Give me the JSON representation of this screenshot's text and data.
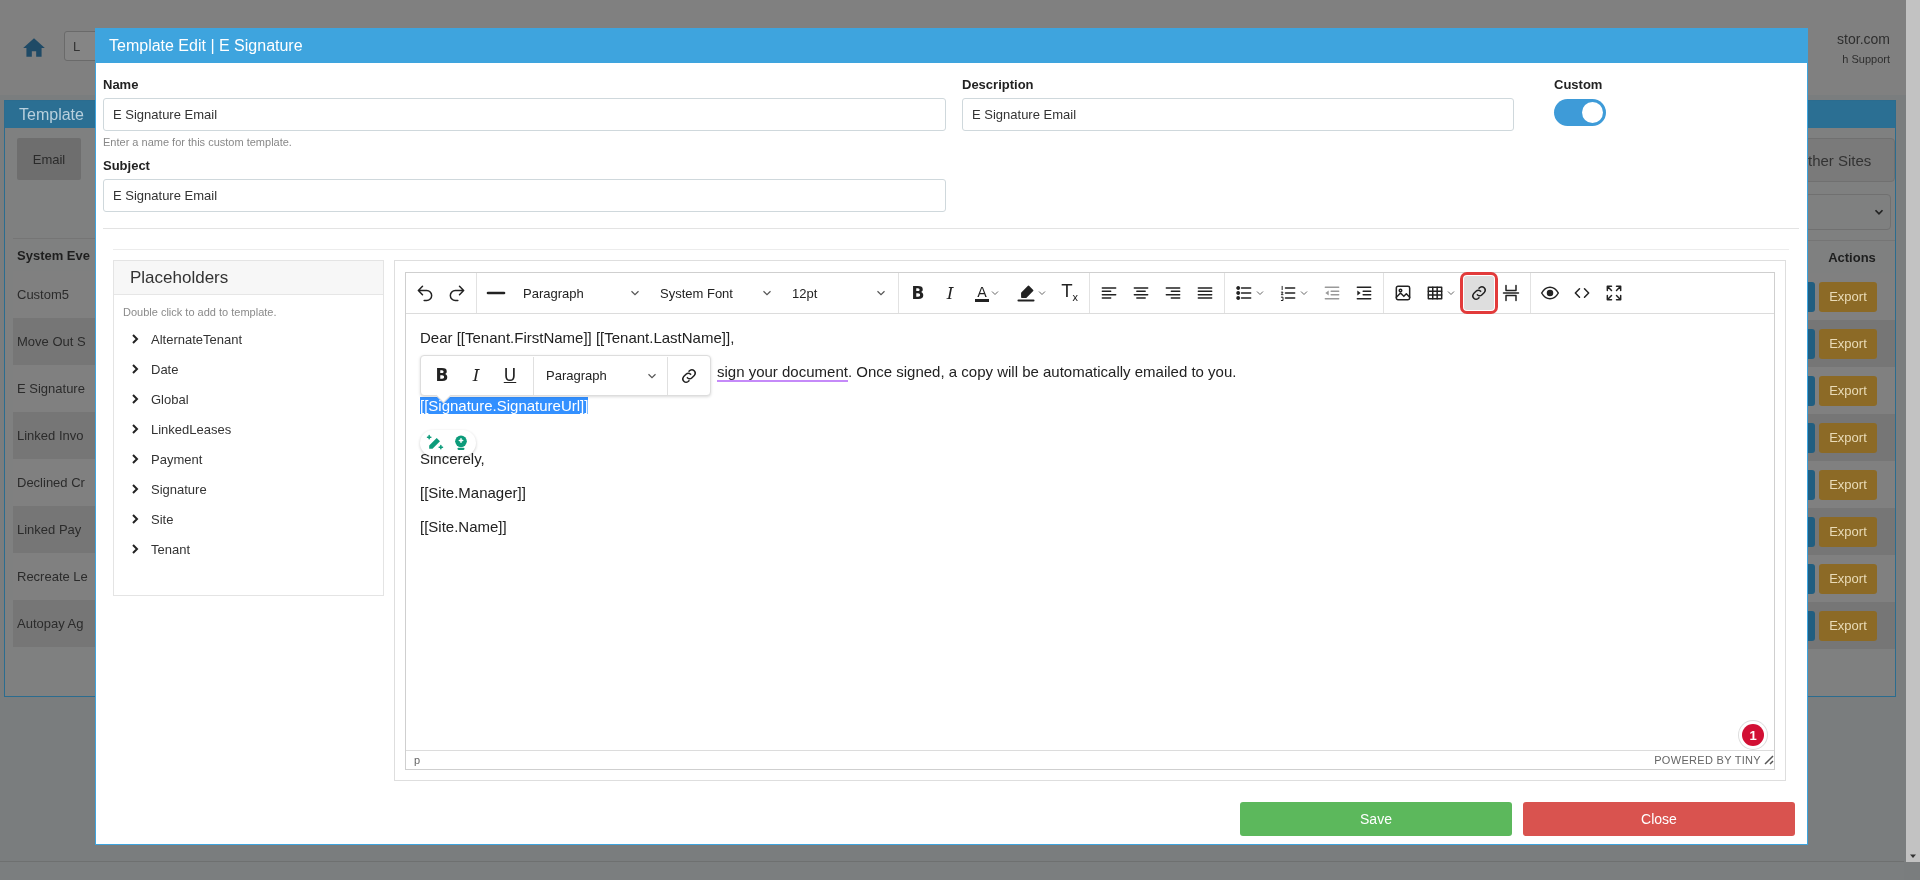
{
  "background": {
    "top_bar": {
      "field": "L",
      "site": "stor.com",
      "support": "h Support"
    },
    "panel": {
      "title": "Template",
      "tabs": [
        {
          "label": "Email"
        }
      ],
      "other_sites": "ther Sites",
      "table": {
        "columns": [
          "System Eve",
          "Actions"
        ],
        "rows": [
          {
            "event": "Custom5",
            "action": "Export"
          },
          {
            "event": "Move Out S",
            "action": "Export"
          },
          {
            "event": "E Signature",
            "action": "Export"
          },
          {
            "event": "Linked Invo",
            "action": "Export"
          },
          {
            "event": "Declined Cr",
            "action": "Export"
          },
          {
            "event": "Linked Pay",
            "action": "Export"
          },
          {
            "event": "Recreate Le",
            "action": "Export"
          },
          {
            "event": "Autopay Ag",
            "action": "Export"
          }
        ]
      }
    }
  },
  "modal": {
    "title": "Template Edit | E Signature",
    "name": {
      "label": "Name",
      "value": "E Signature Email",
      "hint": "Enter a name for this custom template."
    },
    "description": {
      "label": "Description",
      "value": "E Signature Email"
    },
    "custom": {
      "label": "Custom",
      "on": true
    },
    "subject": {
      "label": "Subject",
      "value": "E Signature Email"
    },
    "placeholders": {
      "title": "Placeholders",
      "hint": "Double click to add to template.",
      "items": [
        {
          "label": "AlternateTenant",
          "expanded": false
        },
        {
          "label": "Date",
          "expanded": false
        },
        {
          "label": "Global",
          "expanded": false
        },
        {
          "label": "LinkedLeases",
          "expanded": false
        },
        {
          "label": "Payment",
          "expanded": false
        },
        {
          "label": "Signature",
          "expanded": false
        },
        {
          "label": "Site",
          "expanded": false
        },
        {
          "label": "Tenant",
          "expanded": false
        }
      ]
    },
    "editor": {
      "toolbar": [
        [
          {
            "kind": "undo",
            "selected": false
          },
          {
            "kind": "redo",
            "selected": false
          }
        ],
        [
          {
            "kind": "hr",
            "selected": false
          },
          {
            "kind": "select",
            "value": "Paragraph"
          },
          {
            "kind": "select",
            "value": "System Font"
          },
          {
            "kind": "select",
            "value": "12pt"
          }
        ],
        [
          {
            "kind": "bold",
            "glyph": "B",
            "selected": false
          },
          {
            "kind": "italic",
            "glyph": "I",
            "selected": false
          },
          {
            "kind": "forecolor",
            "glyph": "A",
            "caret": true,
            "selected": false
          },
          {
            "kind": "highlight",
            "caret": true,
            "selected": false
          },
          {
            "kind": "clearformat",
            "glyph": "T$_{x}$",
            "selected": false
          }
        ],
        [
          {
            "kind": "alignleft",
            "selected": false
          },
          {
            "kind": "aligncenter",
            "selected": false
          },
          {
            "kind": "alignright",
            "selected": false
          },
          {
            "kind": "justify",
            "selected": false
          }
        ],
        [
          {
            "kind": "bullist",
            "caret": true,
            "selected": false
          },
          {
            "kind": "numlist",
            "caret": true,
            "selected": false
          },
          {
            "kind": "outdent",
            "selected": false
          },
          {
            "kind": "indent",
            "selected": false
          }
        ],
        [
          {
            "kind": "image",
            "selected": false
          },
          {
            "kind": "table",
            "caret": true,
            "selected": false
          },
          {
            "kind": "link",
            "selected": true
          },
          {
            "kind": "pagebreak",
            "selected": false
          }
        ],
        [
          {
            "kind": "preview",
            "selected": false
          },
          {
            "kind": "code",
            "selected": false
          },
          {
            "kind": "fullscreen",
            "selected": false
          }
        ]
      ],
      "content": [
        {
          "kind": "text",
          "parts": [
            {
              "text": "Dear [[Tenant.FirstName]] [[Tenant.LastName]],",
              "flagged": false
            }
          ]
        },
        {
          "kind": "covered",
          "parts": [
            {
              "text": "sign your document",
              "flagged": true
            },
            {
              "text": ". Once signed, a copy will be automatically emailed to you.",
              "flagged": false
            }
          ]
        },
        {
          "kind": "text",
          "selected": true,
          "parts": [
            {
              "text": "[[Signature.SignatureUrl]]",
              "flagged": false
            }
          ]
        },
        {
          "kind": "text",
          "parts": [
            {
              "text": "Sincerely,",
              "flagged": false
            }
          ]
        },
        {
          "kind": "text",
          "parts": [
            {
              "text": "[[Site.Manager]]",
              "flagged": false
            }
          ]
        },
        {
          "kind": "text",
          "parts": [
            {
              "text": "[[Site.Name]]",
              "flagged": false
            }
          ]
        }
      ],
      "inline_toolbar": [
        {
          "kind": "bold",
          "glyph": "B"
        },
        {
          "kind": "italic",
          "glyph": "I"
        },
        {
          "kind": "underline",
          "glyph": "U"
        },
        {
          "kind": "select",
          "value": "Paragraph"
        },
        {
          "kind": "link"
        }
      ],
      "path": "p",
      "branding": "POWERED BY TINY",
      "badge": "1"
    },
    "buttons": [
      {
        "kind": "save",
        "label": "Save"
      },
      {
        "kind": "close",
        "label": "Close"
      }
    ]
  }
}
